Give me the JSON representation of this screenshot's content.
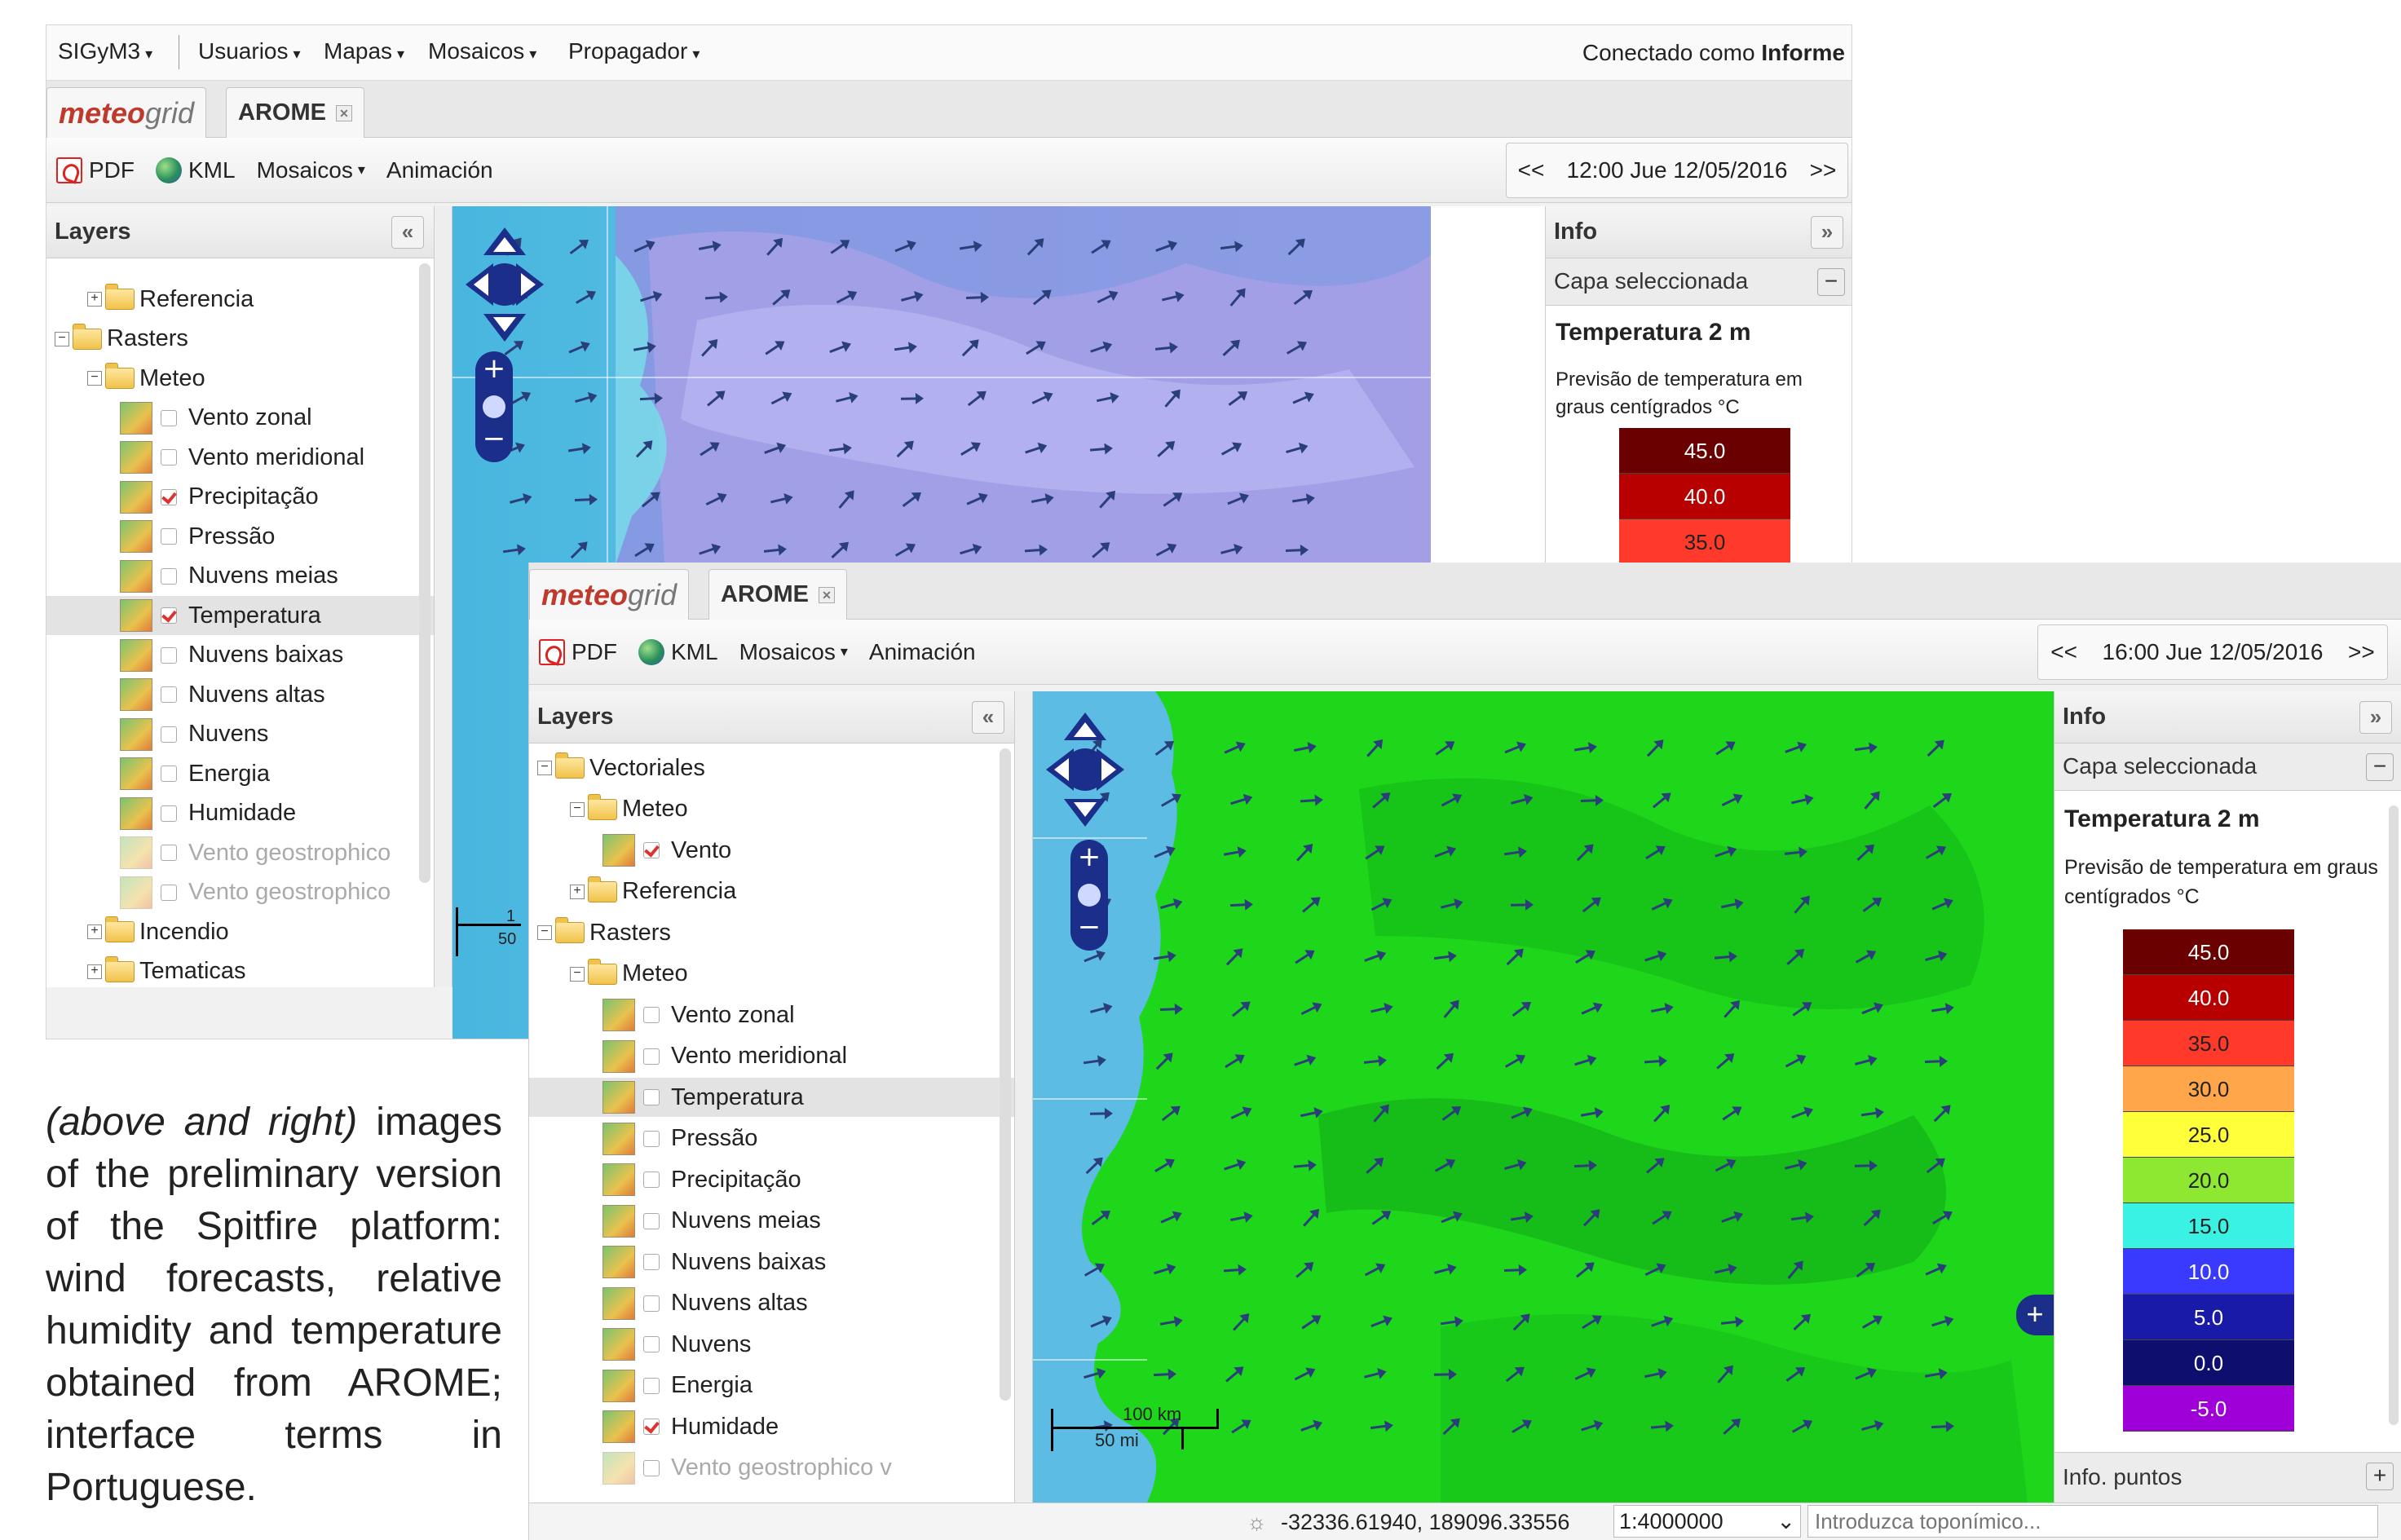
{
  "back": {
    "menubar": {
      "items": [
        "SIGyM3",
        "Usuarios",
        "Mapas",
        "Mosaicos",
        "Propagador"
      ],
      "status_prefix": "Conectado como",
      "status_user": "Informe"
    },
    "tabs": {
      "logo_a": "meteo",
      "logo_b": "grid",
      "second": "AROME"
    },
    "toolbar": {
      "pdf": "PDF",
      "kml": "KML",
      "mosaicos": "Mosaicos",
      "animacion": "Animación",
      "prev": "<<",
      "datetime": "12:00 Jue 12/05/2016",
      "next": ">>"
    },
    "layers": {
      "title": "Layers",
      "rows": [
        {
          "label": "Referencia"
        },
        {
          "label": "Rasters"
        },
        {
          "label": "Meteo"
        },
        {
          "label": "Vento zonal"
        },
        {
          "label": "Vento meridional"
        },
        {
          "label": "Precipitação"
        },
        {
          "label": "Pressão"
        },
        {
          "label": "Nuvens meias"
        },
        {
          "label": "Temperatura"
        },
        {
          "label": "Nuvens baixas"
        },
        {
          "label": "Nuvens altas"
        },
        {
          "label": "Nuvens"
        },
        {
          "label": "Energia"
        },
        {
          "label": "Humidade"
        },
        {
          "label": "Vento geostrophico"
        },
        {
          "label": "Vento geostrophico"
        },
        {
          "label": "Incendio"
        },
        {
          "label": "Tematicas"
        }
      ]
    },
    "scale": {
      "top": "1",
      "bottom": "50"
    },
    "info": {
      "title": "Info",
      "section": "Capa seleccionada",
      "layer_name": "Temperatura 2 m",
      "desc": "Previsão de temperatura em graus centígrados °C",
      "legend": [
        "45.0",
        "40.0",
        "35.0"
      ]
    }
  },
  "front": {
    "tabs": {
      "logo_a": "meteo",
      "logo_b": "grid",
      "second": "AROME"
    },
    "toolbar": {
      "pdf": "PDF",
      "kml": "KML",
      "mosaicos": "Mosaicos",
      "animacion": "Animación",
      "prev": "<<",
      "datetime": "16:00 Jue 12/05/2016",
      "next": ">>"
    },
    "layers": {
      "title": "Layers",
      "rows": [
        {
          "label": "Vectoriales"
        },
        {
          "label": "Meteo"
        },
        {
          "label": "Vento"
        },
        {
          "label": "Referencia"
        },
        {
          "label": "Rasters"
        },
        {
          "label": "Meteo"
        },
        {
          "label": "Vento zonal"
        },
        {
          "label": "Vento meridional"
        },
        {
          "label": "Temperatura"
        },
        {
          "label": "Pressão"
        },
        {
          "label": "Precipitação"
        },
        {
          "label": "Nuvens meias"
        },
        {
          "label": "Nuvens baixas"
        },
        {
          "label": "Nuvens altas"
        },
        {
          "label": "Nuvens"
        },
        {
          "label": "Energia"
        },
        {
          "label": "Humidade"
        },
        {
          "label": "Vento geostrophico v"
        }
      ]
    },
    "scale": {
      "km": "100 km",
      "mi": "50 mi"
    },
    "info": {
      "title": "Info",
      "section": "Capa seleccionada",
      "layer_name": "Temperatura 2 m",
      "desc": "Previsão de temperatura em graus centígrados °C",
      "legend": [
        {
          "value": "45.0",
          "color": "#6b0000"
        },
        {
          "value": "40.0",
          "color": "#b80000"
        },
        {
          "value": "35.0",
          "color": "#ff3a2a"
        },
        {
          "value": "30.0",
          "color": "#ffa54a"
        },
        {
          "value": "25.0",
          "color": "#ffff3a"
        },
        {
          "value": "20.0",
          "color": "#8ee832"
        },
        {
          "value": "15.0",
          "color": "#3af2e4"
        },
        {
          "value": "10.0",
          "color": "#3a3aff"
        },
        {
          "value": "5.0",
          "color": "#1a1aa8"
        },
        {
          "value": "0.0",
          "color": "#0e0e6e"
        },
        {
          "value": "-5.0",
          "color": "#a000d8"
        }
      ],
      "footer": "Info. puntos"
    },
    "statusbar": {
      "coords": "-32336.61940, 189096.33556",
      "scale": "1:4000000",
      "search_placeholder": "Introduzca toponímico..."
    }
  },
  "caption": {
    "italic": "(above and right)",
    "text": "images of the preliminary version of the Spitfire platform: wind forecasts, relative humidity and temperature obtained from AROME; interface terms in Portuguese."
  }
}
